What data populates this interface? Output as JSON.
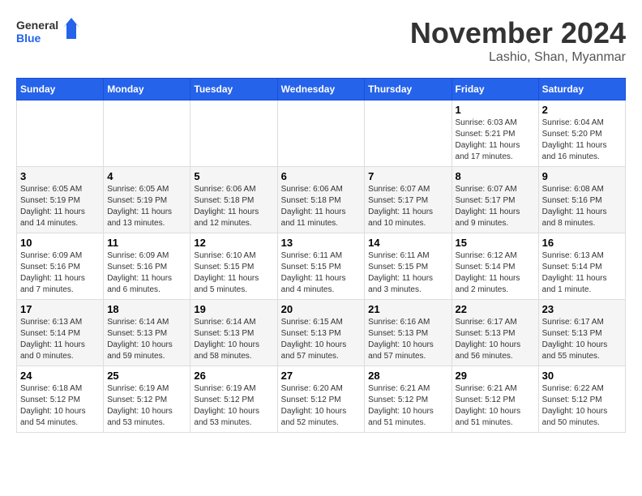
{
  "header": {
    "logo_line1": "General",
    "logo_line2": "Blue",
    "month_title": "November 2024",
    "location": "Lashio, Shan, Myanmar"
  },
  "weekdays": [
    "Sunday",
    "Monday",
    "Tuesday",
    "Wednesday",
    "Thursday",
    "Friday",
    "Saturday"
  ],
  "weeks": [
    [
      {
        "day": "",
        "info": ""
      },
      {
        "day": "",
        "info": ""
      },
      {
        "day": "",
        "info": ""
      },
      {
        "day": "",
        "info": ""
      },
      {
        "day": "",
        "info": ""
      },
      {
        "day": "1",
        "info": "Sunrise: 6:03 AM\nSunset: 5:21 PM\nDaylight: 11 hours and 17 minutes."
      },
      {
        "day": "2",
        "info": "Sunrise: 6:04 AM\nSunset: 5:20 PM\nDaylight: 11 hours and 16 minutes."
      }
    ],
    [
      {
        "day": "3",
        "info": "Sunrise: 6:05 AM\nSunset: 5:19 PM\nDaylight: 11 hours and 14 minutes."
      },
      {
        "day": "4",
        "info": "Sunrise: 6:05 AM\nSunset: 5:19 PM\nDaylight: 11 hours and 13 minutes."
      },
      {
        "day": "5",
        "info": "Sunrise: 6:06 AM\nSunset: 5:18 PM\nDaylight: 11 hours and 12 minutes."
      },
      {
        "day": "6",
        "info": "Sunrise: 6:06 AM\nSunset: 5:18 PM\nDaylight: 11 hours and 11 minutes."
      },
      {
        "day": "7",
        "info": "Sunrise: 6:07 AM\nSunset: 5:17 PM\nDaylight: 11 hours and 10 minutes."
      },
      {
        "day": "8",
        "info": "Sunrise: 6:07 AM\nSunset: 5:17 PM\nDaylight: 11 hours and 9 minutes."
      },
      {
        "day": "9",
        "info": "Sunrise: 6:08 AM\nSunset: 5:16 PM\nDaylight: 11 hours and 8 minutes."
      }
    ],
    [
      {
        "day": "10",
        "info": "Sunrise: 6:09 AM\nSunset: 5:16 PM\nDaylight: 11 hours and 7 minutes."
      },
      {
        "day": "11",
        "info": "Sunrise: 6:09 AM\nSunset: 5:16 PM\nDaylight: 11 hours and 6 minutes."
      },
      {
        "day": "12",
        "info": "Sunrise: 6:10 AM\nSunset: 5:15 PM\nDaylight: 11 hours and 5 minutes."
      },
      {
        "day": "13",
        "info": "Sunrise: 6:11 AM\nSunset: 5:15 PM\nDaylight: 11 hours and 4 minutes."
      },
      {
        "day": "14",
        "info": "Sunrise: 6:11 AM\nSunset: 5:15 PM\nDaylight: 11 hours and 3 minutes."
      },
      {
        "day": "15",
        "info": "Sunrise: 6:12 AM\nSunset: 5:14 PM\nDaylight: 11 hours and 2 minutes."
      },
      {
        "day": "16",
        "info": "Sunrise: 6:13 AM\nSunset: 5:14 PM\nDaylight: 11 hours and 1 minute."
      }
    ],
    [
      {
        "day": "17",
        "info": "Sunrise: 6:13 AM\nSunset: 5:14 PM\nDaylight: 11 hours and 0 minutes."
      },
      {
        "day": "18",
        "info": "Sunrise: 6:14 AM\nSunset: 5:13 PM\nDaylight: 10 hours and 59 minutes."
      },
      {
        "day": "19",
        "info": "Sunrise: 6:14 AM\nSunset: 5:13 PM\nDaylight: 10 hours and 58 minutes."
      },
      {
        "day": "20",
        "info": "Sunrise: 6:15 AM\nSunset: 5:13 PM\nDaylight: 10 hours and 57 minutes."
      },
      {
        "day": "21",
        "info": "Sunrise: 6:16 AM\nSunset: 5:13 PM\nDaylight: 10 hours and 57 minutes."
      },
      {
        "day": "22",
        "info": "Sunrise: 6:17 AM\nSunset: 5:13 PM\nDaylight: 10 hours and 56 minutes."
      },
      {
        "day": "23",
        "info": "Sunrise: 6:17 AM\nSunset: 5:13 PM\nDaylight: 10 hours and 55 minutes."
      }
    ],
    [
      {
        "day": "24",
        "info": "Sunrise: 6:18 AM\nSunset: 5:12 PM\nDaylight: 10 hours and 54 minutes."
      },
      {
        "day": "25",
        "info": "Sunrise: 6:19 AM\nSunset: 5:12 PM\nDaylight: 10 hours and 53 minutes."
      },
      {
        "day": "26",
        "info": "Sunrise: 6:19 AM\nSunset: 5:12 PM\nDaylight: 10 hours and 53 minutes."
      },
      {
        "day": "27",
        "info": "Sunrise: 6:20 AM\nSunset: 5:12 PM\nDaylight: 10 hours and 52 minutes."
      },
      {
        "day": "28",
        "info": "Sunrise: 6:21 AM\nSunset: 5:12 PM\nDaylight: 10 hours and 51 minutes."
      },
      {
        "day": "29",
        "info": "Sunrise: 6:21 AM\nSunset: 5:12 PM\nDaylight: 10 hours and 51 minutes."
      },
      {
        "day": "30",
        "info": "Sunrise: 6:22 AM\nSunset: 5:12 PM\nDaylight: 10 hours and 50 minutes."
      }
    ]
  ]
}
